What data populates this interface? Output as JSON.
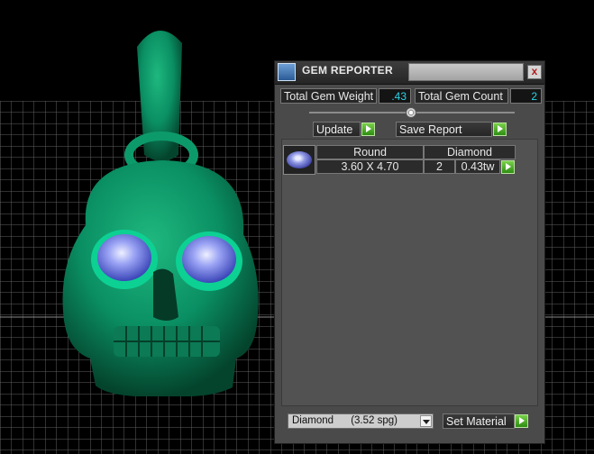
{
  "panel": {
    "title": "GEM REPORTER",
    "close_glyph": "x",
    "total_weight_label": "Total Gem Weight",
    "total_weight_value": ".43",
    "total_count_label": "Total Gem Count",
    "total_count_value": "2",
    "update_label": "Update",
    "save_report_label": "Save Report",
    "gem_row": {
      "shape_header": "Round",
      "material_header": "Diamond",
      "size": "3.60 X 4.70",
      "count": "2",
      "weight": "0.43tw"
    },
    "material_select_value": "Diamond      (3.52 spg)",
    "set_material_label": "Set Material"
  },
  "icons": {
    "title": "gem-reporter-app-icon",
    "close": "close-icon",
    "arrow": "green-play-arrow-icon",
    "gem": "round-gem-thumbnail-icon",
    "dropdown": "chevron-down-icon"
  },
  "colors": {
    "skull": "#0a8f63",
    "gem_eyes": "#7d8df0",
    "value_text": "#28d4e6",
    "arrow_button": "#4caf2a",
    "panel_bg": "#4a4a4a",
    "grid": "#5f5f5f"
  }
}
